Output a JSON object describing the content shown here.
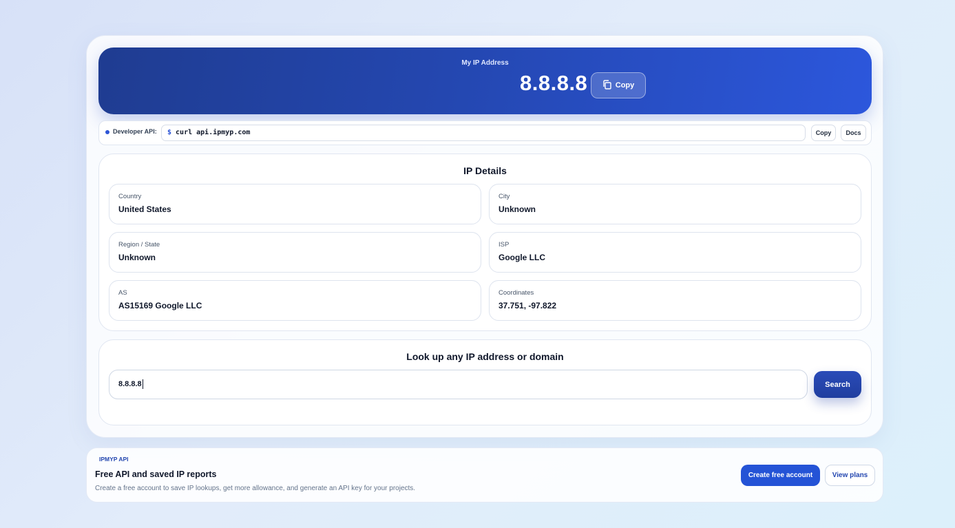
{
  "hero": {
    "label": "My IP Address",
    "ip": "8.8.8.8",
    "copy_label": "Copy"
  },
  "api": {
    "label": "Developer API:",
    "prompt": "$",
    "command": "curl api.ipmyp.com",
    "copy_label": "Copy",
    "docs_label": "Docs"
  },
  "details": {
    "title": "IP Details",
    "items": [
      {
        "label": "Country",
        "value": "United States"
      },
      {
        "label": "City",
        "value": "Unknown"
      },
      {
        "label": "Region / State",
        "value": "Unknown"
      },
      {
        "label": "ISP",
        "value": "Google LLC"
      },
      {
        "label": "AS",
        "value": "AS15169 Google LLC"
      },
      {
        "label": "Coordinates",
        "value": "37.751, -97.822"
      }
    ]
  },
  "lookup": {
    "title": "Look up any IP address or domain",
    "input_value": "8.8.8.8",
    "search_label": "Search"
  },
  "promo": {
    "tag": "IPMYP API",
    "title": "Free API and saved IP reports",
    "description": "Create a free account to save IP lookups, get more allowance, and generate an API key for your projects.",
    "create_label": "Create free account",
    "plans_label": "View plans"
  },
  "colors": {
    "accent": "#2453d6",
    "hero_start": "#1f3c91",
    "hero_end": "#2c57dc"
  },
  "icons": {
    "copy": "copy-icon"
  }
}
